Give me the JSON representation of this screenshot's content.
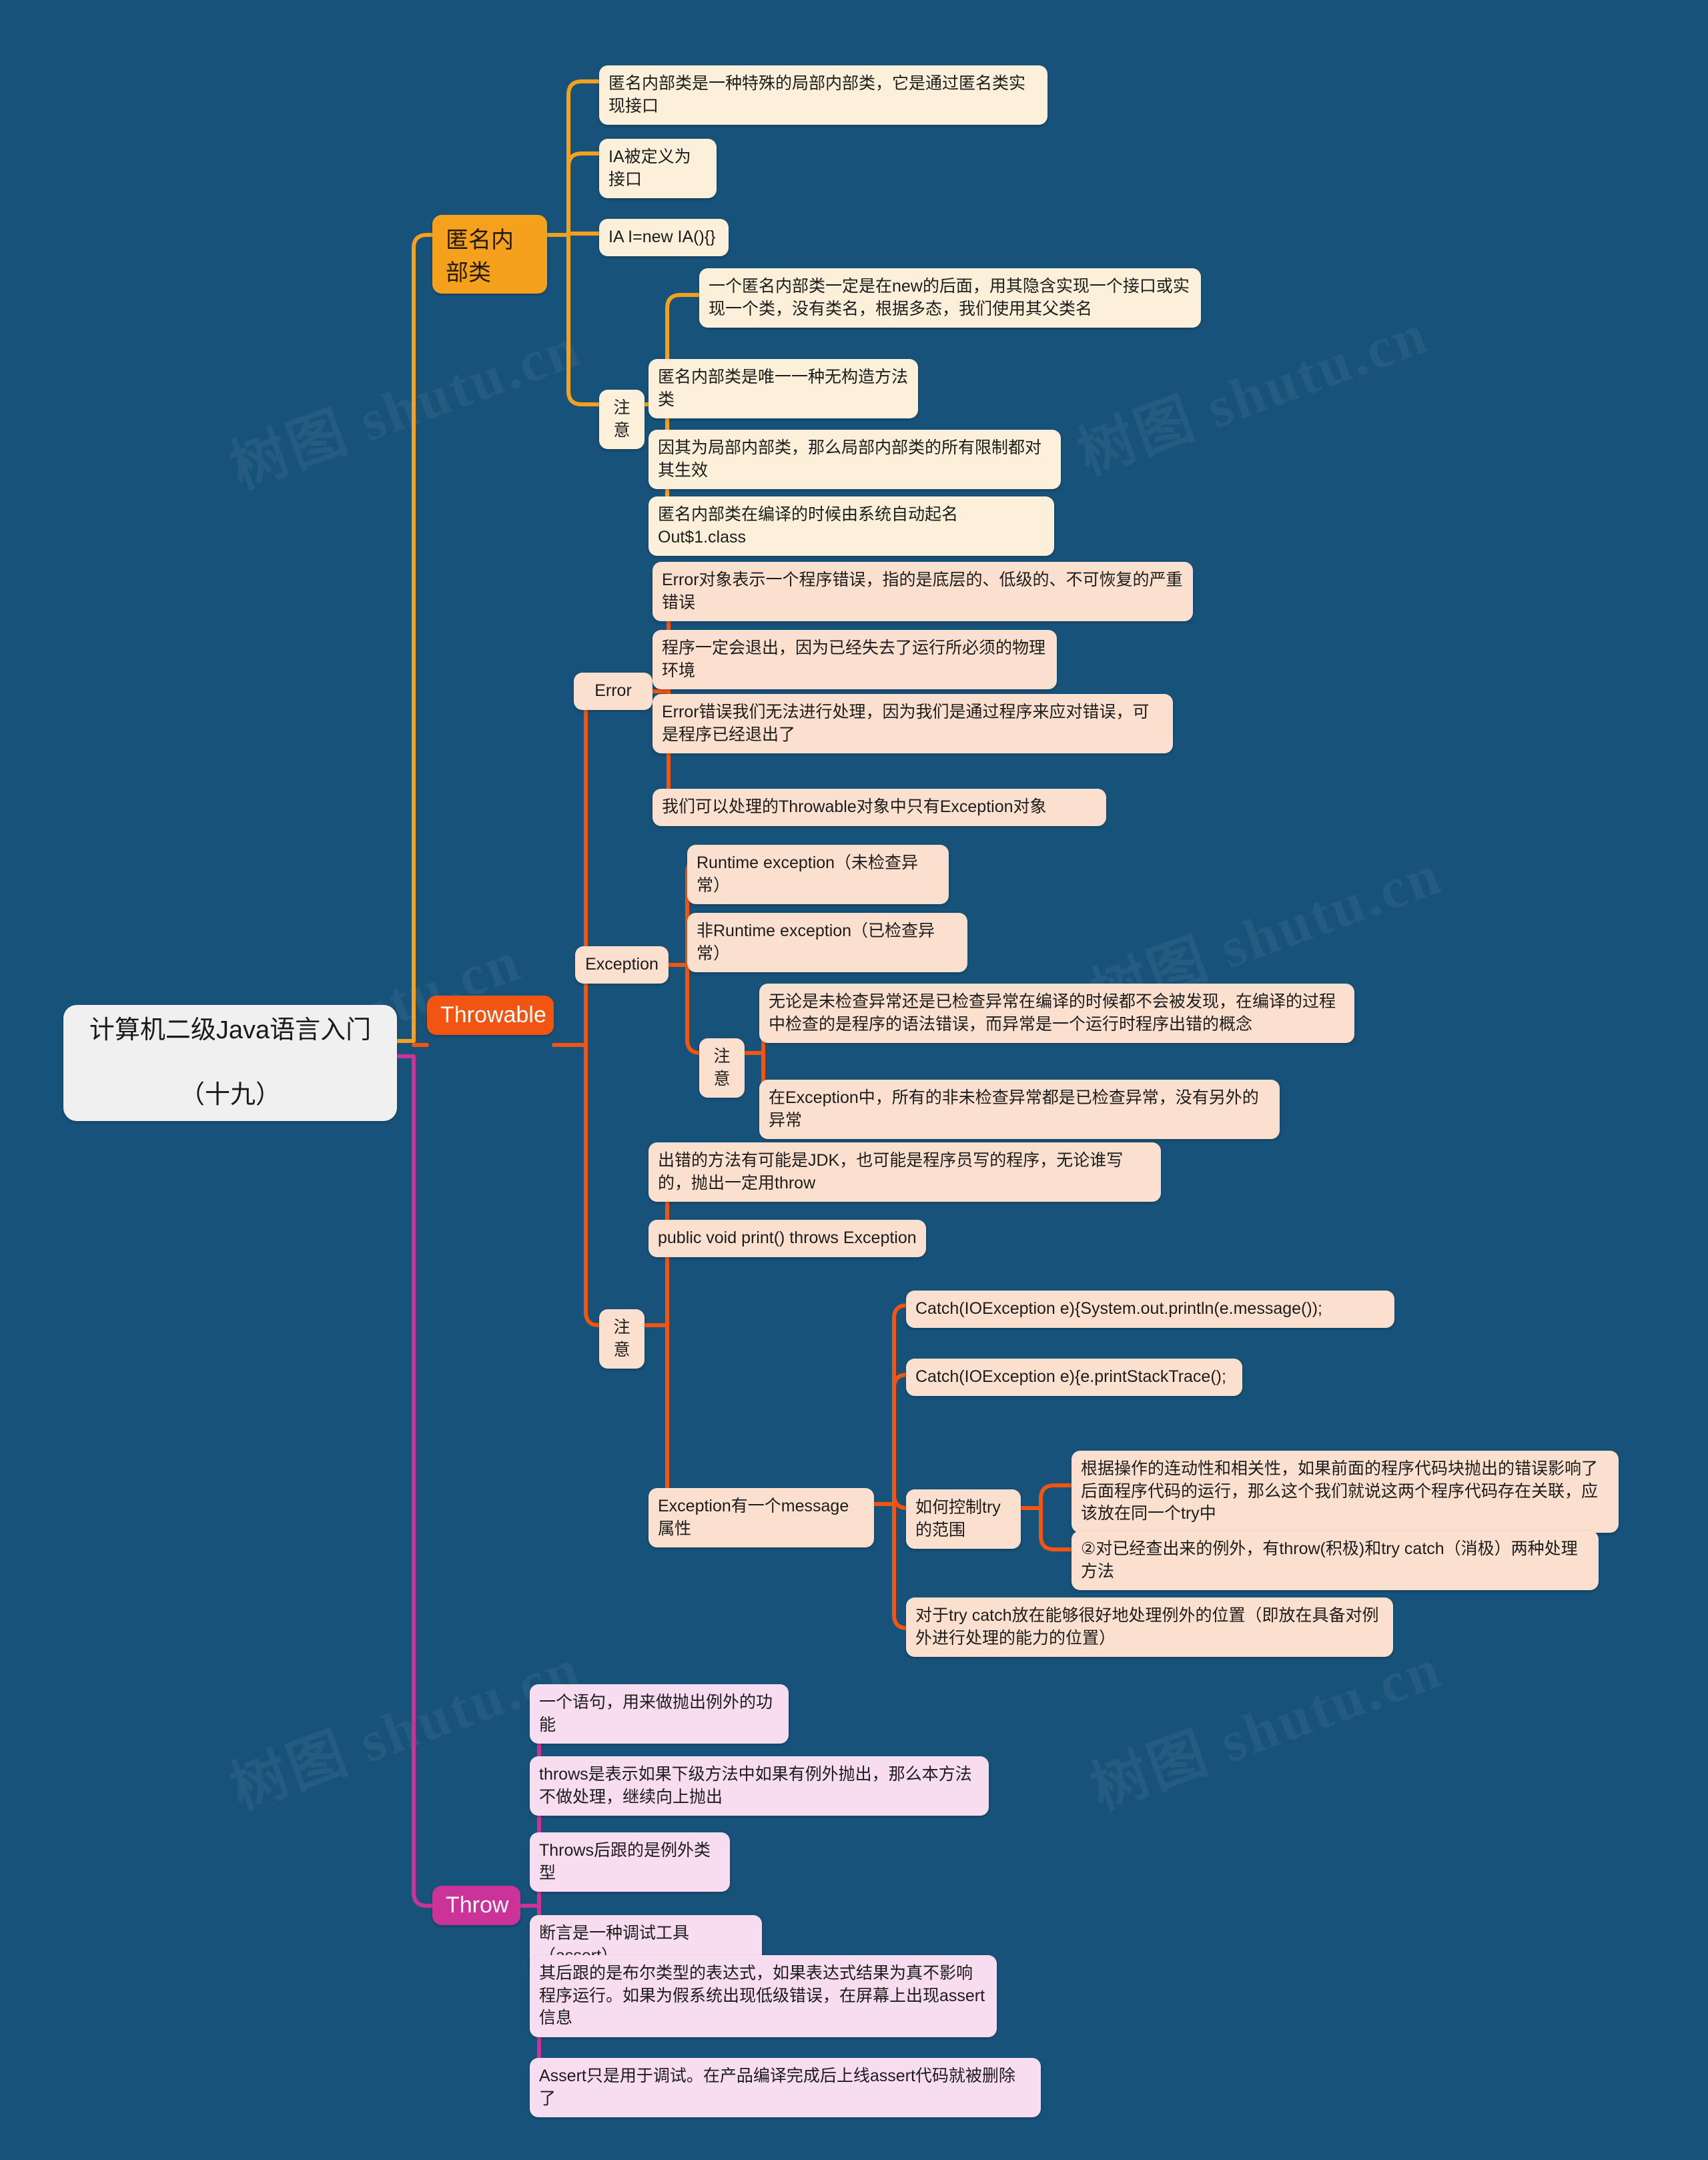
{
  "meta": {
    "background_color": "#17527a",
    "watermark_text": "树图 shutu.cn"
  },
  "mindmap": {
    "root": {
      "label": "计算机二级Java语言入门（十九）",
      "line1": "计算机二级Java语言入门",
      "line2": "（十九）",
      "color": "#f0f0f0"
    },
    "branches": [
      {
        "label": "匿名内部类",
        "color": "#f5a11e",
        "leaf_color": "#fcf0da",
        "children": [
          {
            "label": "匿名内部类是一种特殊的局部内部类，它是通过匿名类实现接口"
          },
          {
            "label": "IA被定义为接口"
          },
          {
            "label": "IA I=new IA(){}"
          },
          {
            "label": "注意",
            "children": [
              {
                "label": "一个匿名内部类一定是在new的后面，用其隐含实现一个接口或实现一个类，没有类名，根据多态，我们使用其父类名"
              },
              {
                "label": "匿名内部类是唯一一种无构造方法类"
              },
              {
                "label": "因其为局部内部类，那么局部内部类的所有限制都对其生效"
              },
              {
                "label": "匿名内部类在编译的时候由系统自动起名Out$1.class"
              }
            ]
          }
        ]
      },
      {
        "label": "Throwable",
        "color": "#f25511",
        "leaf_color": "#fce0cf",
        "children": [
          {
            "label": "Error",
            "children": [
              {
                "label": "Error对象表示一个程序错误，指的是底层的、低级的、不可恢复的严重错误"
              },
              {
                "label": "程序一定会退出，因为已经失去了运行所必须的物理环境"
              },
              {
                "label": "Error错误我们无法进行处理，因为我们是通过程序来应对错误，可是程序已经退出了"
              },
              {
                "label": "我们可以处理的Throwable对象中只有Exception对象"
              }
            ]
          },
          {
            "label": "Exception",
            "children": [
              {
                "label": "Runtime exception（未检查异常）"
              },
              {
                "label": "非Runtime exception（已检查异常）"
              },
              {
                "label": "注意",
                "children": [
                  {
                    "label": "无论是未检查异常还是已检查异常在编译的时候都不会被发现，在编译的过程中检查的是程序的语法错误，而异常是一个运行时程序出错的概念"
                  },
                  {
                    "label": "在Exception中，所有的非未检查异常都是已检查异常，没有另外的异常"
                  }
                ]
              }
            ]
          },
          {
            "label": "注意",
            "children": [
              {
                "label": "出错的方法有可能是JDK，也可能是程序员写的程序，无论谁写的，抛出一定用throw"
              },
              {
                "label": "public void print() throws Exception"
              },
              {
                "label": "Exception有一个message属性",
                "children": [
                  {
                    "label": "Catch(IOException e){System.out.println(e.message());"
                  },
                  {
                    "label": "Catch(IOException e){e.printStackTrace();"
                  },
                  {
                    "label": "如何控制try的范围",
                    "children": [
                      {
                        "label": "根据操作的连动性和相关性，如果前面的程序代码块抛出的错误影响了后面程序代码的运行，那么这个我们就说这两个程序代码存在关联，应该放在同一个try中"
                      },
                      {
                        "label": "②对已经查出来的例外，有throw(积极)和try catch（消极）两种处理方法"
                      }
                    ]
                  },
                  {
                    "label": "对于try catch放在能够很好地处理例外的位置（即放在具备对例外进行处理的能力的位置）"
                  }
                ]
              }
            ]
          }
        ]
      },
      {
        "label": "Throw",
        "color": "#cc3399",
        "leaf_color": "#f8dcef",
        "children": [
          {
            "label": "一个语句，用来做抛出例外的功能"
          },
          {
            "label": "throws是表示如果下级方法中如果有例外抛出，那么本方法不做处理，继续向上抛出"
          },
          {
            "label": "Throws后跟的是例外类型"
          },
          {
            "label": "断言是一种调试工具（assert）"
          },
          {
            "label": "其后跟的是布尔类型的表达式，如果表达式结果为真不影响程序运行。如果为假系统出现低级错误，在屏幕上出现assert信息"
          },
          {
            "label": "Assert只是用于调试。在产品编译完成后上线assert代码就被删除了"
          }
        ]
      }
    ]
  }
}
